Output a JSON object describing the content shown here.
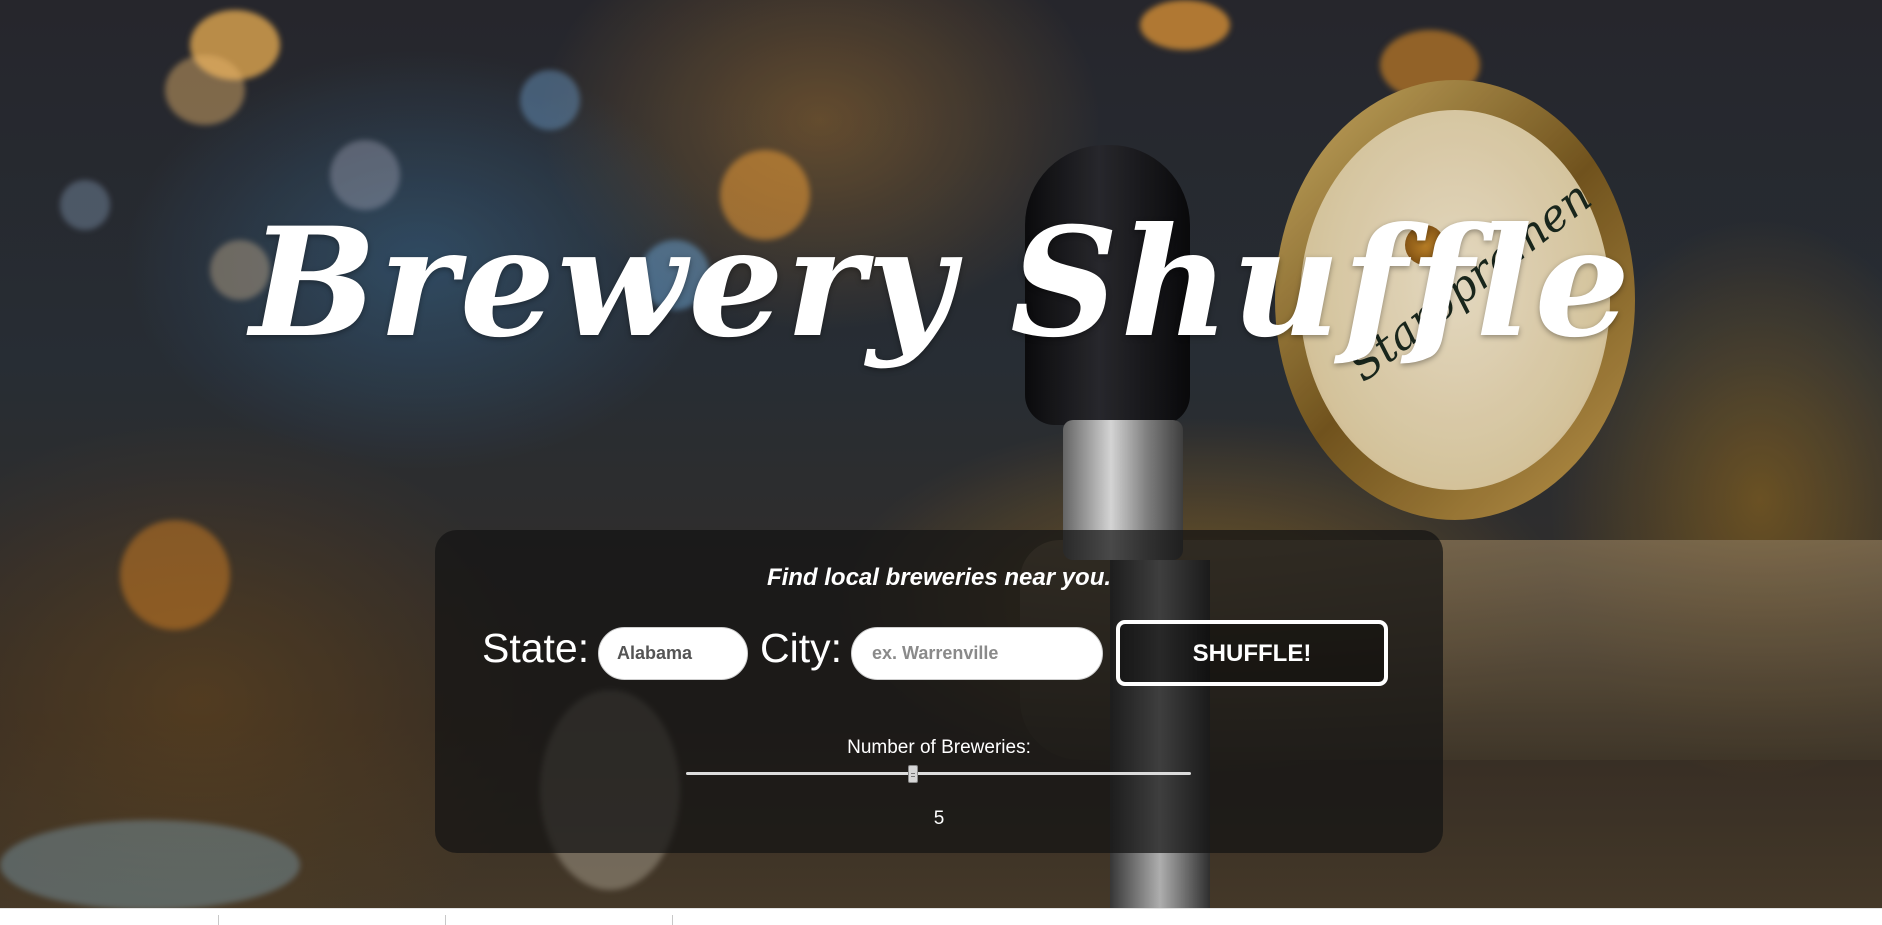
{
  "app": {
    "title": "Brewery Shuffle",
    "tagline": "Find local breweries near you."
  },
  "form": {
    "state_label": "State:",
    "state_value": "Alabama",
    "city_label": "City:",
    "city_value": "",
    "city_placeholder": "ex. Warrenville",
    "submit_label": "SHUFFLE!"
  },
  "slider": {
    "label": "Number of Breweries:",
    "value": 5,
    "value_text": "5",
    "fill_fraction": 0.45
  },
  "colors": {
    "panel": "#141414",
    "text": "#ffffff",
    "button_border": "#ffffff"
  },
  "icons": [
    "slider-thumb-icon"
  ]
}
